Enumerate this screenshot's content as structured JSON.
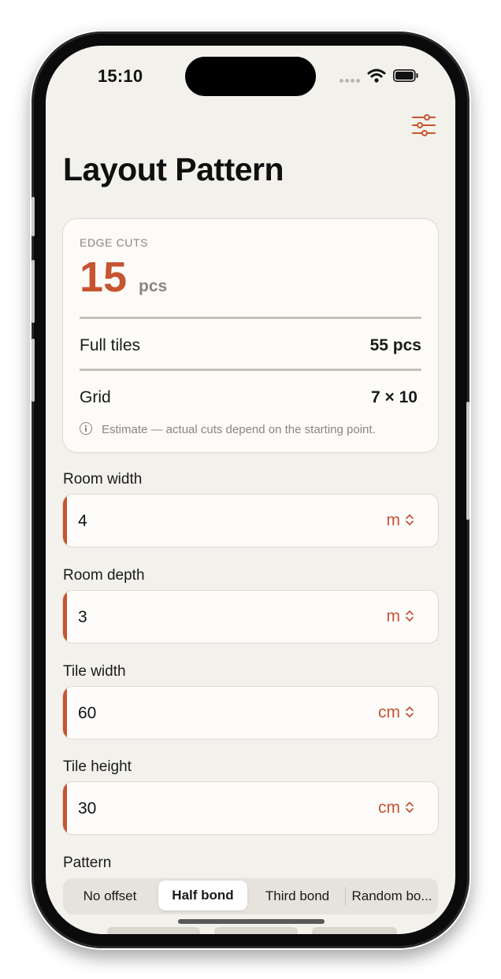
{
  "status_bar": {
    "time": "15:10"
  },
  "header": {
    "title": "Layout Pattern",
    "settings_icon": "sliders-icon"
  },
  "summary": {
    "label": "EDGE CUTS",
    "edge_cuts_value": "15",
    "edge_cuts_unit": "pcs",
    "rows": [
      {
        "label": "Full tiles",
        "value": "55 pcs"
      },
      {
        "label": "Grid",
        "value": "7 × 10"
      }
    ],
    "note": "Estimate — actual cuts depend on the starting point.",
    "note_icon": "info-icon"
  },
  "fields": [
    {
      "label": "Room width",
      "value": "4",
      "unit": "m"
    },
    {
      "label": "Room depth",
      "value": "3",
      "unit": "m"
    },
    {
      "label": "Tile width",
      "value": "60",
      "unit": "cm"
    },
    {
      "label": "Tile height",
      "value": "30",
      "unit": "cm"
    }
  ],
  "pattern": {
    "label": "Pattern",
    "options": [
      "No offset",
      "Half bond",
      "Third bond",
      "Random bo..."
    ],
    "selected": "Half bond"
  },
  "colors": {
    "accent": "#c75431",
    "background": "#f3f1ec",
    "card": "#fcfbf8"
  }
}
